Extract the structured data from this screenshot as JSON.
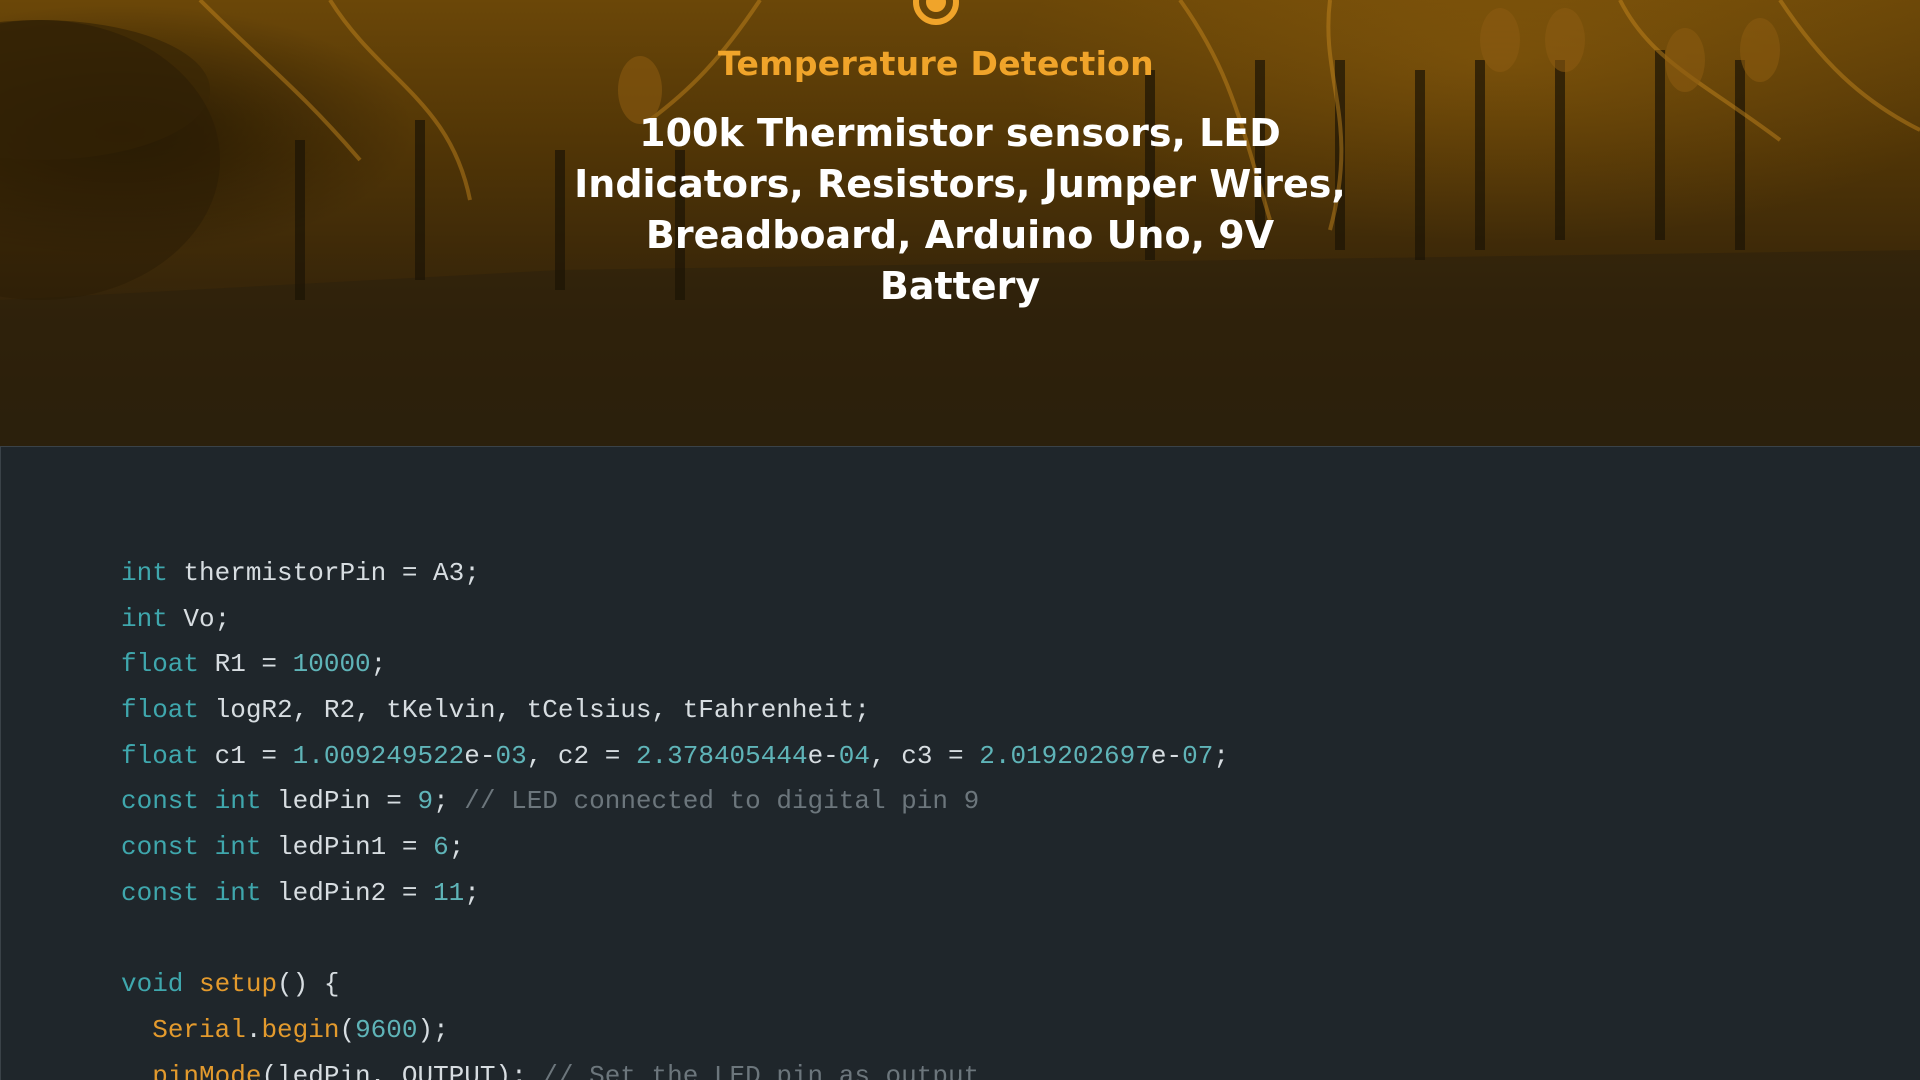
{
  "hero": {
    "label": "Temperature Detection",
    "title": "100k Thermistor sensors, LED Indicators, Resistors, Jumper Wires, Breadboard, Arduino Uno, 9V Battery",
    "icon": "target-icon",
    "accent_color": "#f0a42a"
  },
  "code": {
    "lines": [
      [
        {
          "t": "int",
          "k": "kw"
        },
        {
          "t": " thermistorPin = A3;",
          "k": "plain"
        }
      ],
      [
        {
          "t": "int",
          "k": "kw"
        },
        {
          "t": " Vo;",
          "k": "plain"
        }
      ],
      [
        {
          "t": "float",
          "k": "kw"
        },
        {
          "t": " R1 = ",
          "k": "plain"
        },
        {
          "t": "10000",
          "k": "num"
        },
        {
          "t": ";",
          "k": "plain"
        }
      ],
      [
        {
          "t": "float",
          "k": "kw"
        },
        {
          "t": " logR2, R2, tKelvin, tCelsius, tFahrenheit;",
          "k": "plain"
        }
      ],
      [
        {
          "t": "float",
          "k": "kw"
        },
        {
          "t": " c1 = ",
          "k": "plain"
        },
        {
          "t": "1.009249522",
          "k": "num"
        },
        {
          "t": "e-",
          "k": "plain"
        },
        {
          "t": "03",
          "k": "num"
        },
        {
          "t": ", c2 = ",
          "k": "plain"
        },
        {
          "t": "2.378405444",
          "k": "num"
        },
        {
          "t": "e-",
          "k": "plain"
        },
        {
          "t": "04",
          "k": "num"
        },
        {
          "t": ", c3 = ",
          "k": "plain"
        },
        {
          "t": "2.019202697",
          "k": "num"
        },
        {
          "t": "e-",
          "k": "plain"
        },
        {
          "t": "07",
          "k": "num"
        },
        {
          "t": ";",
          "k": "plain"
        }
      ],
      [
        {
          "t": "const",
          "k": "kw"
        },
        {
          "t": " ",
          "k": "plain"
        },
        {
          "t": "int",
          "k": "kw"
        },
        {
          "t": " ledPin = ",
          "k": "plain"
        },
        {
          "t": "9",
          "k": "num"
        },
        {
          "t": "; ",
          "k": "plain"
        },
        {
          "t": "// LED connected to digital pin 9",
          "k": "com"
        }
      ],
      [
        {
          "t": "const",
          "k": "kw"
        },
        {
          "t": " ",
          "k": "plain"
        },
        {
          "t": "int",
          "k": "kw"
        },
        {
          "t": " ledPin1 = ",
          "k": "plain"
        },
        {
          "t": "6",
          "k": "num"
        },
        {
          "t": ";",
          "k": "plain"
        }
      ],
      [
        {
          "t": "const",
          "k": "kw"
        },
        {
          "t": " ",
          "k": "plain"
        },
        {
          "t": "int",
          "k": "kw"
        },
        {
          "t": " ledPin2 = ",
          "k": "plain"
        },
        {
          "t": "11",
          "k": "num"
        },
        {
          "t": ";",
          "k": "plain"
        }
      ],
      [],
      [
        {
          "t": "void",
          "k": "kw"
        },
        {
          "t": " ",
          "k": "plain"
        },
        {
          "t": "setup",
          "k": "fn"
        },
        {
          "t": "() {",
          "k": "plain"
        }
      ],
      [
        {
          "t": "  ",
          "k": "plain"
        },
        {
          "t": "Serial",
          "k": "fn"
        },
        {
          "t": ".",
          "k": "plain"
        },
        {
          "t": "begin",
          "k": "fn"
        },
        {
          "t": "(",
          "k": "plain"
        },
        {
          "t": "9600",
          "k": "num"
        },
        {
          "t": ");",
          "k": "plain"
        }
      ],
      [
        {
          "t": "  ",
          "k": "plain"
        },
        {
          "t": "pinMode",
          "k": "fn"
        },
        {
          "t": "(ledPin, OUTPUT); ",
          "k": "plain"
        },
        {
          "t": "// Set the LED pin as output",
          "k": "com"
        }
      ]
    ]
  }
}
